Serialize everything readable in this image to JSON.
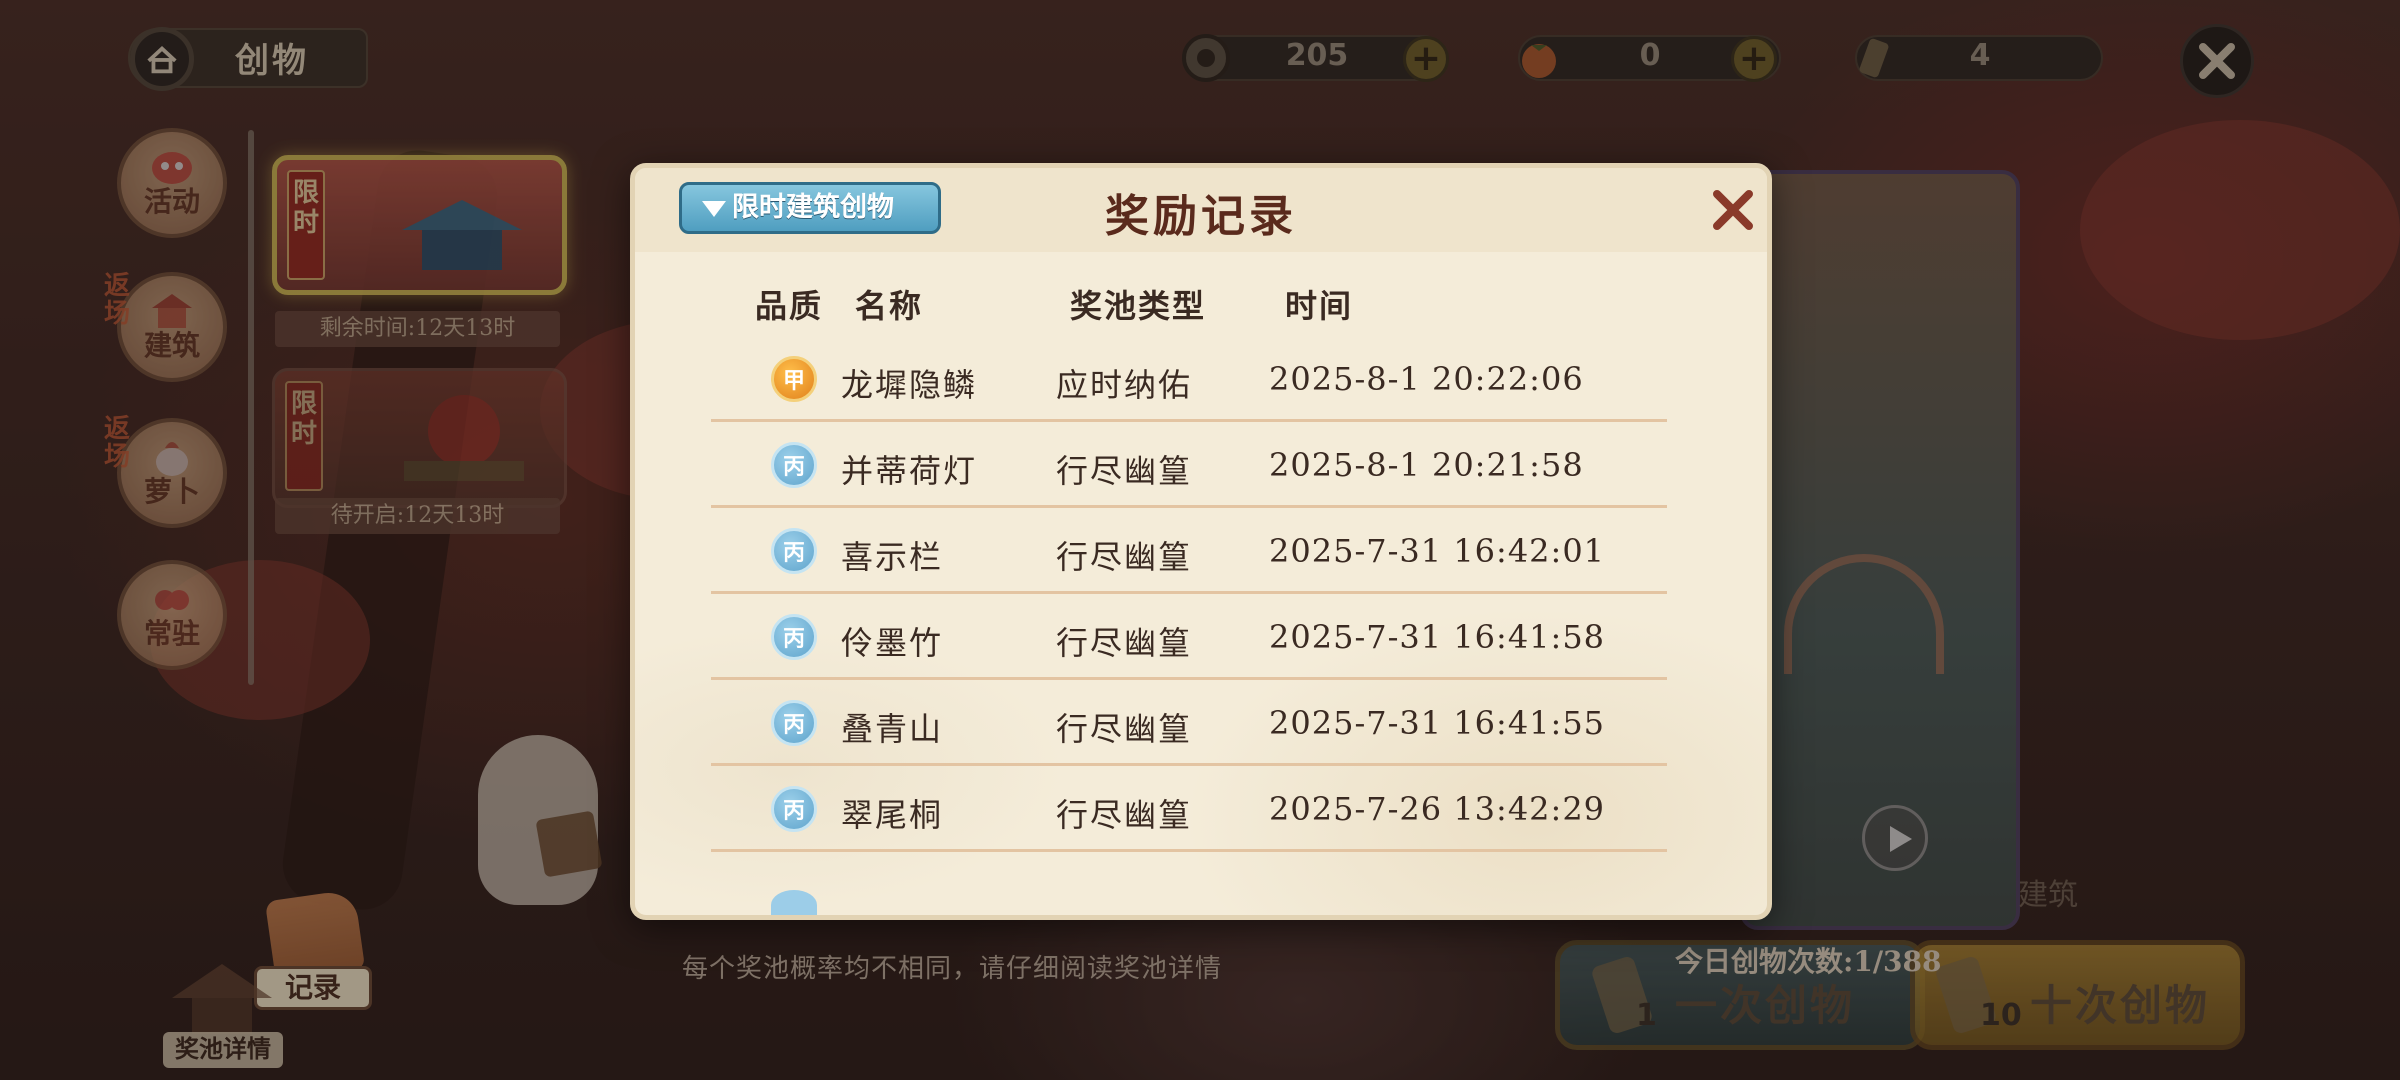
{
  "top": {
    "title": "创物",
    "currencies": [
      {
        "name": "coin-icon",
        "value": "205"
      },
      {
        "name": "persimmon-icon",
        "value": "0"
      },
      {
        "name": "scroll-icon",
        "value": "4"
      }
    ]
  },
  "left_nav": {
    "items": [
      {
        "label": "活动",
        "tag": ""
      },
      {
        "label": "建筑",
        "tag": "返场"
      },
      {
        "label": "萝卜",
        "tag": "返场"
      },
      {
        "label": "常驻",
        "tag": ""
      }
    ]
  },
  "banners": [
    {
      "flag": "限时",
      "caption": "剩余时间:12天13时"
    },
    {
      "flag": "限时",
      "caption": "待开启:12天13时"
    }
  ],
  "modal": {
    "title": "奖励记录",
    "filter_label": "限时建筑创物",
    "columns": {
      "quality": "品质",
      "name": "名称",
      "pool": "奖池类型",
      "time": "时间"
    },
    "rows": [
      {
        "grade": "甲",
        "grade_color": "#e8901e",
        "name": "龙墀隐鳞",
        "pool": "应时纳佑",
        "time": "2025-8-1  20:22:06"
      },
      {
        "grade": "丙",
        "grade_color": "#6aaed4",
        "name": "并蒂荷灯",
        "pool": "行尽幽篁",
        "time": "2025-8-1  20:21:58"
      },
      {
        "grade": "丙",
        "grade_color": "#6aaed4",
        "name": "喜示栏",
        "pool": "行尽幽篁",
        "time": "2025-7-31  16:42:01"
      },
      {
        "grade": "丙",
        "grade_color": "#6aaed4",
        "name": "伶墨竹",
        "pool": "行尽幽篁",
        "time": "2025-7-31  16:41:58"
      },
      {
        "grade": "丙",
        "grade_color": "#6aaed4",
        "name": "叠青山",
        "pool": "行尽幽篁",
        "time": "2025-7-31  16:41:55"
      },
      {
        "grade": "丙",
        "grade_color": "#6aaed4",
        "name": "翠尾桐",
        "pool": "行尽幽篁",
        "time": "2025-7-26  13:42:29"
      }
    ]
  },
  "bottom": {
    "hint": "每个奖池概率均不相同，请仔细阅读奖池详情",
    "daily_count": "今日创物次数:1/388",
    "draw_one": {
      "label": "一次创物",
      "cost": "1"
    },
    "draw_ten": {
      "label": "十次创物",
      "cost": "10"
    },
    "record_tab": "记录",
    "pool_details": "奖池详情",
    "side_label": "建筑"
  }
}
